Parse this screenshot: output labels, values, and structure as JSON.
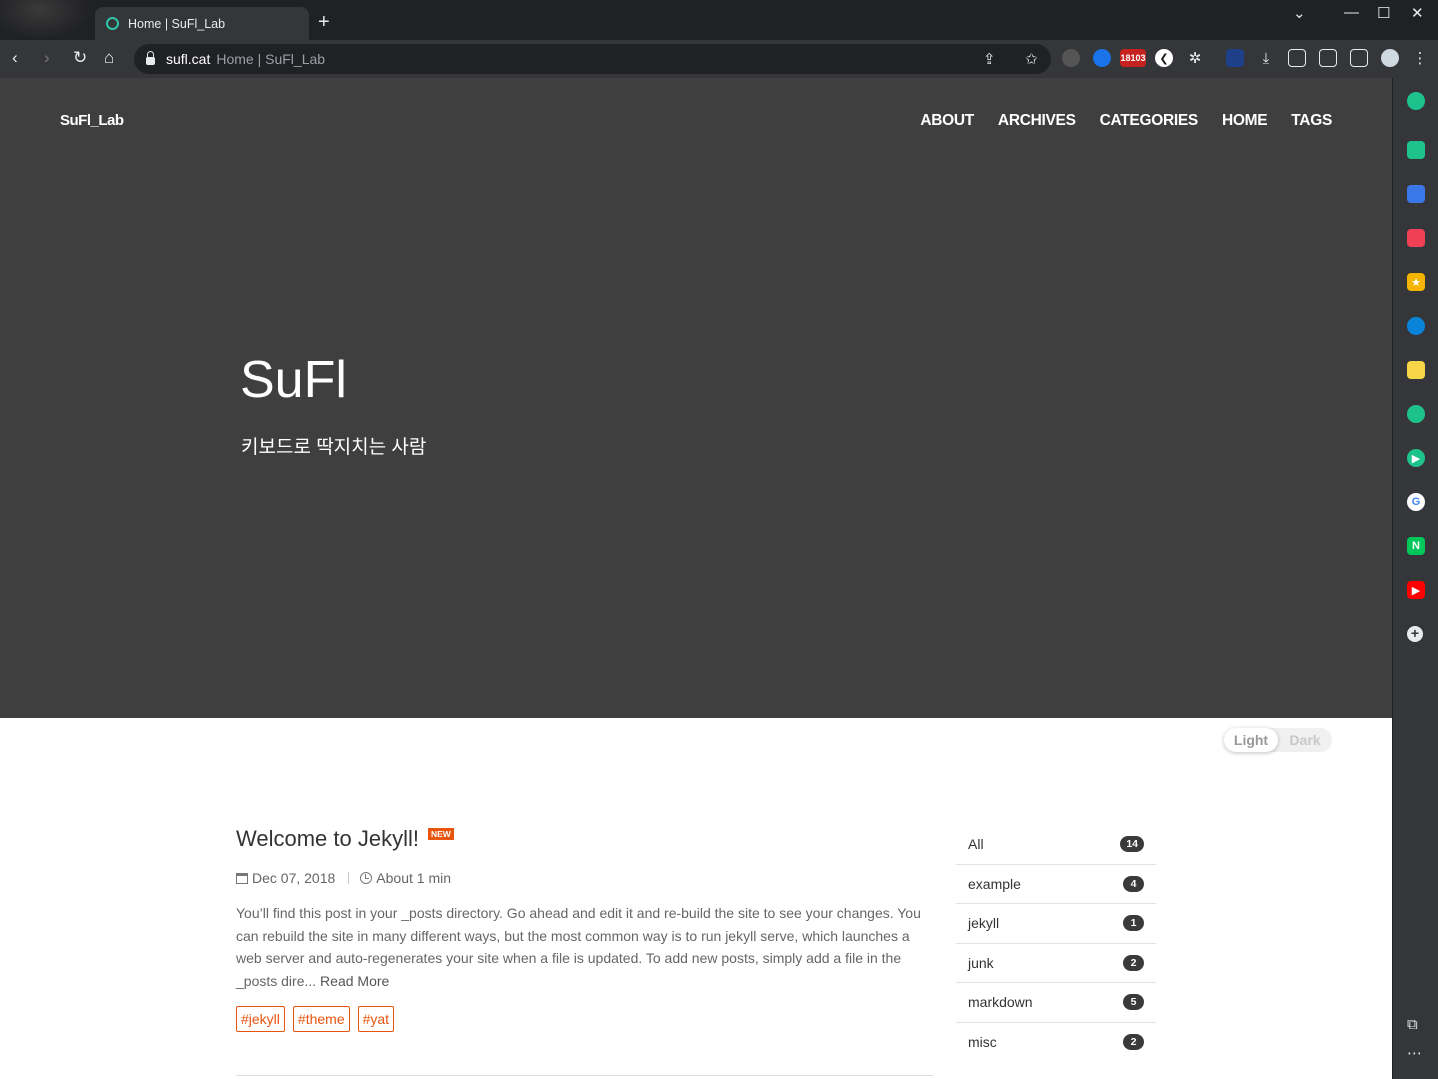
{
  "browser": {
    "tab_title": "Home | SuFl_Lab",
    "new_tab": "+",
    "url_host": "sufl.cat",
    "url_page_title": "Home | SuFl_Lab",
    "ext_badge": "18103"
  },
  "site": {
    "brand": "SuFl_Lab",
    "nav": [
      "ABOUT",
      "ARCHIVES",
      "CATEGORIES",
      "HOME",
      "TAGS"
    ],
    "hero_title": "SuFl",
    "hero_subtitle": "키보드로 딱지치는 사람",
    "theme_toggle": {
      "light": "Light",
      "dark": "Dark"
    }
  },
  "post": {
    "title": "Welcome to Jekyll!",
    "badge": "NEW",
    "date": "Dec 07, 2018",
    "read_time": "About 1 min",
    "excerpt": "You’ll find this post in your _posts directory. Go ahead and edit it and re-build the site to see your changes. You can rebuild the site in many different ways, but the most common way is to run jekyll serve, which launches a web server and auto-regenerates your site when a file is updated. To add new posts, simply add a file in the _posts dire...",
    "read_more": "Read More",
    "tags": [
      "#jekyll",
      "#theme",
      "#yat"
    ]
  },
  "categories": [
    {
      "name": "All",
      "count": "14"
    },
    {
      "name": "example",
      "count": "4"
    },
    {
      "name": "jekyll",
      "count": "1"
    },
    {
      "name": "junk",
      "count": "2"
    },
    {
      "name": "markdown",
      "count": "5"
    },
    {
      "name": "misc",
      "count": "2"
    }
  ],
  "colors": {
    "hero_bg": "#3f3f3f",
    "accent": "#e8550f",
    "chrome_dark": "#202124",
    "chrome_toolbar": "#35363a"
  }
}
